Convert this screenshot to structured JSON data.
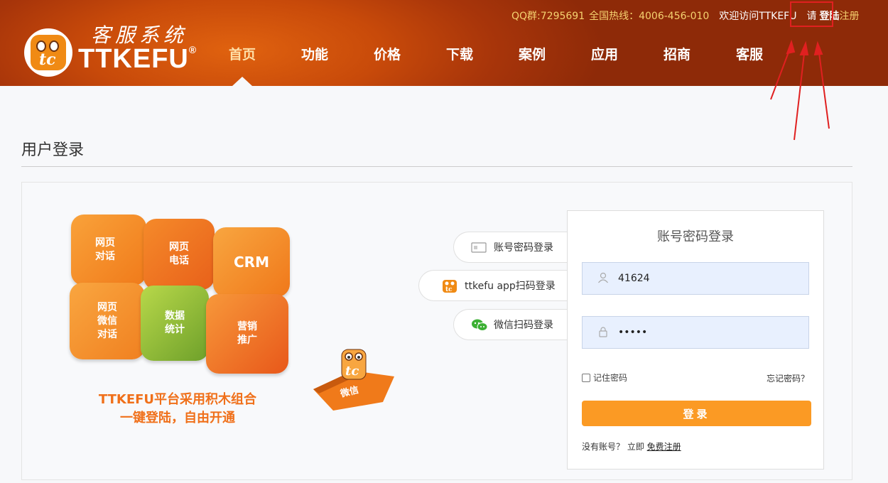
{
  "header": {
    "logo_text": "TTKEFU",
    "logo_reg": "®",
    "logo_script": "客服系统",
    "topbar": {
      "qq": "QQ群:7295691",
      "hotline": "全国热线：4006-456-010",
      "welcome": "欢迎访问TTKEFU",
      "please": "请",
      "login": "登陆",
      "register": "注册"
    },
    "nav": [
      "首页",
      "功能",
      "价格",
      "下载",
      "案例",
      "应用",
      "招商",
      "客服"
    ],
    "active_nav": "首页"
  },
  "page": {
    "title": "用户登录"
  },
  "illustration": {
    "pieces": [
      "网页\n对话",
      "网页\n电话",
      "CRM",
      "网页\n微信\n对话",
      "数据\n统计",
      "营销\n推广"
    ],
    "wechat_piece": "微信",
    "tagline_1": "TTKEFU平台采用积木组合",
    "tagline_2": "一键登陆，自由开通"
  },
  "login_tabs": [
    {
      "label": "账号密码登录",
      "icon": "card-icon"
    },
    {
      "label": "ttkefu app扫码登录",
      "icon": "ttkefu-app-icon"
    },
    {
      "label": "微信扫码登录",
      "icon": "wechat-icon"
    }
  ],
  "login_form": {
    "title": "账号密码登录",
    "username_value": "41624",
    "password_value": "•••••",
    "remember_label": "记住密码",
    "forgot_label": "忘记密码？",
    "submit_label": "登录",
    "no_account_text": "没有账号？ 立即",
    "register_link": "免费注册"
  },
  "colors": {
    "header_dark": "#8e2a08",
    "header_light": "#e0620f",
    "accent": "#fb9a24",
    "annotation_red": "#e02020"
  }
}
